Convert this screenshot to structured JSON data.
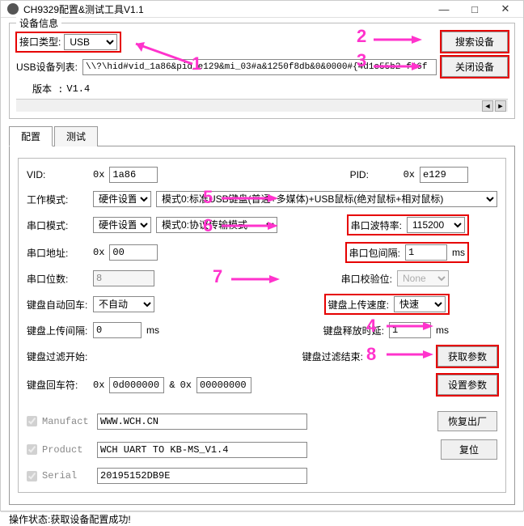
{
  "window": {
    "title": "CH9329配置&测试工具V1.1",
    "min": "—",
    "max": "□",
    "close": "✕"
  },
  "device_info": {
    "group_title": "设备信息",
    "iface_type_label": "接口类型:",
    "iface_type_value": "USB",
    "search_btn": "搜索设备",
    "close_btn": "关闭设备",
    "usb_list_label": "USB设备列表:",
    "usb_list_value": "\\\\?\\hid#vid_1a86&pid_e129&mi_03#a&1250f8db&0&0000#{4d1e55b2-f16f",
    "version_label": "版本 :",
    "version_value": "V1.4"
  },
  "tabs": {
    "config": "配置",
    "test": "测试"
  },
  "config": {
    "vid_label": "VID:",
    "vid_prefix": "0x",
    "vid_value": "1a86",
    "pid_label": "PID:",
    "pid_prefix": "0x",
    "pid_value": "e129",
    "work_mode_label": "工作模式:",
    "work_mode_sel": "硬件设置",
    "work_mode_desc": "模式0:标准USB键盘(普通+多媒体)+USB鼠标(绝对鼠标+相对鼠标)",
    "serial_mode_label": "串口模式:",
    "serial_mode_sel": "硬件设置",
    "serial_mode_desc": "模式0:协议传输模式",
    "baud_label": "串口波特率:",
    "baud_value": "115200",
    "serial_addr_label": "串口地址:",
    "serial_addr_prefix": "0x",
    "serial_addr_value": "00",
    "pkt_interval_label": "串口包间隔:",
    "pkt_interval_value": "1",
    "pkt_interval_unit": "ms",
    "serial_bits_label": "串口位数:",
    "serial_bits_value": "8",
    "serial_parity_label": "串口校验位:",
    "serial_parity_value": "None",
    "kb_autocr_label": "键盘自动回车:",
    "kb_autocr_value": "不自动",
    "kb_upspeed_label": "键盘上传速度:",
    "kb_upspeed_value": "快速",
    "kb_upint_label": "键盘上传间隔:",
    "kb_upint_value": "0",
    "kb_upint_unit": "ms",
    "kb_reldelay_label": "键盘释放时延:",
    "kb_reldelay_value": "1",
    "kb_reldelay_unit": "ms",
    "kb_filter_start_label": "键盘过滤开始:",
    "kb_filter_end_label": "键盘过滤结束:",
    "get_params_btn": "获取参数",
    "kb_cr_label": "键盘回车符:",
    "kb_cr_prefix1": "0x",
    "kb_cr_value1": "0d000000",
    "kb_cr_amp": "&",
    "kb_cr_prefix2": "0x",
    "kb_cr_value2": "00000000",
    "set_params_btn": "设置参数",
    "manufact_label": "Manufact",
    "manufact_value": "WWW.WCH.CN",
    "product_label": "Product",
    "product_value": "WCH UART TO KB-MS_V1.4",
    "serial_label": "Serial",
    "serial_value": "20195152DB9E",
    "restore_btn": "恢复出厂",
    "reset_btn": "复位"
  },
  "status": {
    "label": "操作状态:",
    "msg": "获取设备配置成功!"
  },
  "annotations": {
    "n1": "1",
    "n2": "2",
    "n3": "3",
    "n4": "4",
    "n5": "5",
    "n6": "6",
    "n7": "7",
    "n8": "8"
  }
}
